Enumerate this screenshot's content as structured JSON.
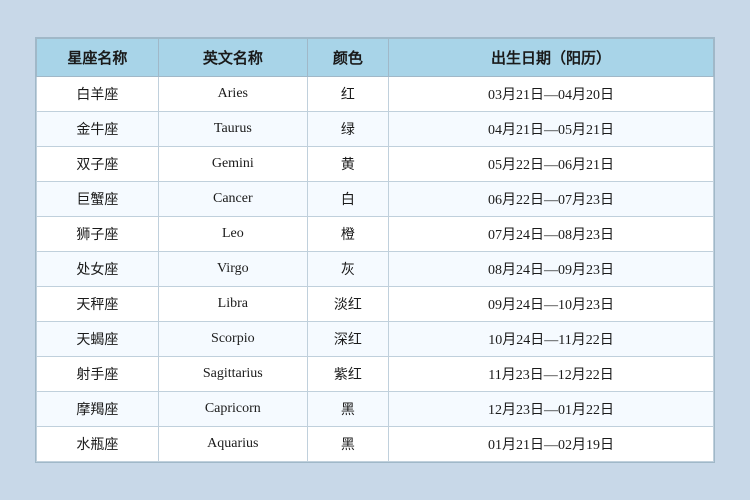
{
  "table": {
    "headers": {
      "chinese_name": "星座名称",
      "english_name": "英文名称",
      "color": "颜色",
      "date": "出生日期（阳历）"
    },
    "rows": [
      {
        "chinese": "白羊座",
        "english": "Aries",
        "color": "红",
        "date": "03月21日—04月20日"
      },
      {
        "chinese": "金牛座",
        "english": "Taurus",
        "color": "绿",
        "date": "04月21日—05月21日"
      },
      {
        "chinese": "双子座",
        "english": "Gemini",
        "color": "黄",
        "date": "05月22日—06月21日"
      },
      {
        "chinese": "巨蟹座",
        "english": "Cancer",
        "color": "白",
        "date": "06月22日—07月23日"
      },
      {
        "chinese": "狮子座",
        "english": "Leo",
        "color": "橙",
        "date": "07月24日—08月23日"
      },
      {
        "chinese": "处女座",
        "english": "Virgo",
        "color": "灰",
        "date": "08月24日—09月23日"
      },
      {
        "chinese": "天秤座",
        "english": "Libra",
        "color": "淡红",
        "date": "09月24日—10月23日"
      },
      {
        "chinese": "天蝎座",
        "english": "Scorpio",
        "color": "深红",
        "date": "10月24日—11月22日"
      },
      {
        "chinese": "射手座",
        "english": "Sagittarius",
        "color": "紫红",
        "date": "11月23日—12月22日"
      },
      {
        "chinese": "摩羯座",
        "english": "Capricorn",
        "color": "黑",
        "date": "12月23日—01月22日"
      },
      {
        "chinese": "水瓶座",
        "english": "Aquarius",
        "color": "黑",
        "date": "01月21日—02月19日"
      }
    ]
  }
}
